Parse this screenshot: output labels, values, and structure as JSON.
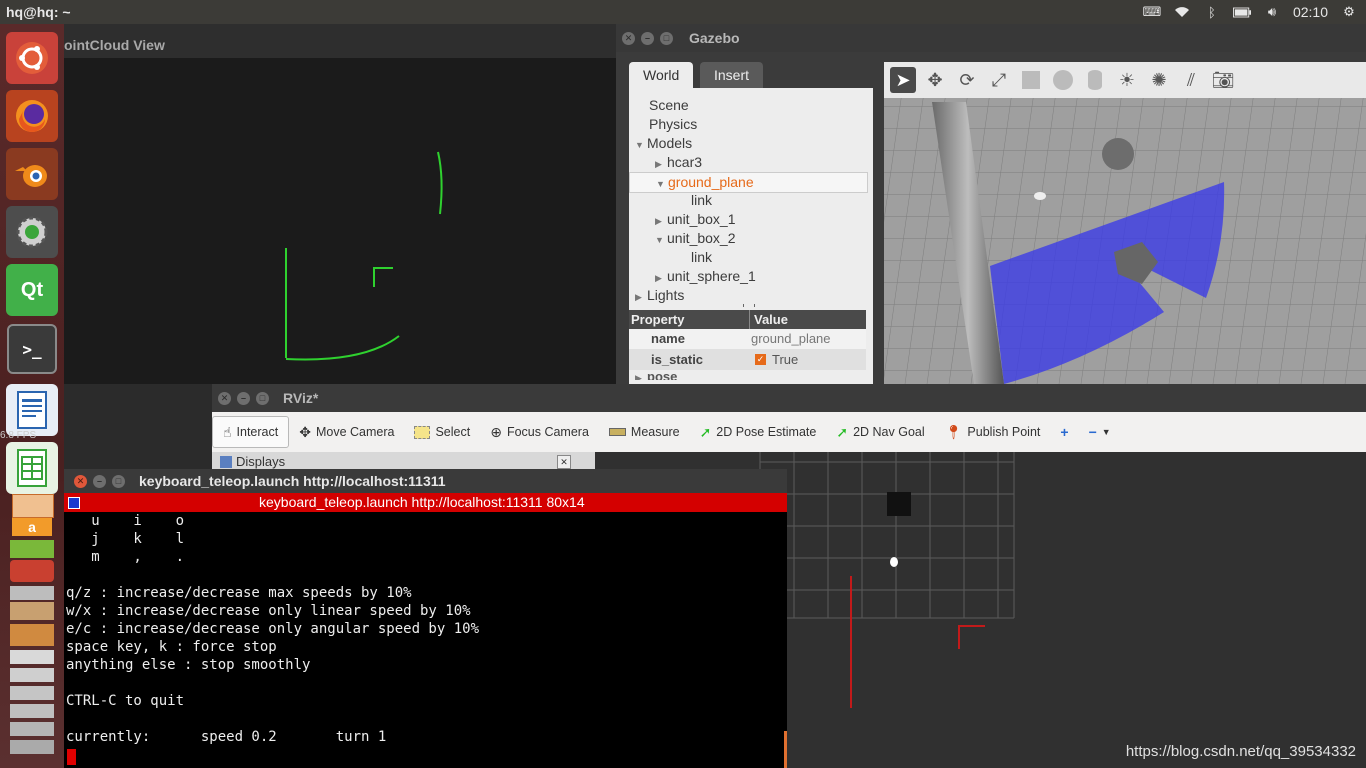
{
  "topbar": {
    "title": "hq@hq: ~",
    "clock": "02:10",
    "icons": [
      "keyboard-icon",
      "wifi-icon",
      "bluetooth-icon",
      "battery-icon",
      "volume-icon",
      "gear-icon"
    ]
  },
  "launcher": {
    "items": [
      "ubuntu-dash",
      "firefox",
      "blender",
      "system-settings",
      "qt-creator",
      "terminal",
      "libreoffice-writer",
      "libreoffice-calc",
      "libreoffice-impress",
      "amazon",
      "stacked-apps"
    ],
    "qt_label": "Qt",
    "fps_text": "6.8 FPS"
  },
  "pointcloud": {
    "title": "ointCloud View"
  },
  "gazebo": {
    "title": "Gazebo",
    "tabs": [
      "World",
      "Insert"
    ],
    "tree": {
      "scene": "Scene",
      "physics": "Physics",
      "models": "Models",
      "hcar3": "hcar3",
      "ground_plane": "ground_plane",
      "link1": "link",
      "unit_box_1": "unit_box_1",
      "unit_box_2": "unit_box_2",
      "link2": "link",
      "unit_sphere_1": "unit_sphere_1",
      "lights": "Lights"
    },
    "properties": {
      "header_property": "Property",
      "header_value": "Value",
      "name_key": "name",
      "name_value": "ground_plane",
      "static_key": "is_static",
      "static_value": "True",
      "pose_key": "pose"
    },
    "toolbar_icons": [
      "select-arrow-icon",
      "translate-icon",
      "rotate-icon",
      "scale-icon",
      "box-icon",
      "sphere-icon",
      "cylinder-icon",
      "point-light-icon",
      "spot-light-icon",
      "directional-light-icon",
      "screenshot-icon"
    ]
  },
  "rviz": {
    "title": "RViz*",
    "tools": {
      "interact": "Interact",
      "move_camera": "Move Camera",
      "select": "Select",
      "focus_camera": "Focus Camera",
      "measure": "Measure",
      "pose_estimate": "2D Pose Estimate",
      "nav_goal": "2D Nav Goal",
      "publish_point": "Publish Point"
    },
    "displays_label": "Displays"
  },
  "terminal": {
    "title": "keyboard_teleop.launch http://localhost:11311",
    "bar_text": "keyboard_teleop.launch http://localhost:11311 80x14",
    "lines": [
      "   u    i    o",
      "   j    k    l",
      "   m    ,    .",
      "",
      "q/z : increase/decrease max speeds by 10%",
      "w/x : increase/decrease only linear speed by 10%",
      "e/c : increase/decrease only angular speed by 10%",
      "space key, k : force stop",
      "anything else : stop smoothly",
      "",
      "CTRL-C to quit",
      "",
      "currently:      speed 0.2       turn 1"
    ]
  },
  "watermark": "https://blog.csdn.net/qq_39534332",
  "colors": {
    "launcher_bg": "#5a2a2a",
    "gazebo_highlight": "#e66a1a",
    "laser_blue": "#3a3ae8",
    "pointcloud_green": "#2fd12f",
    "terminal_red": "#d40000"
  }
}
